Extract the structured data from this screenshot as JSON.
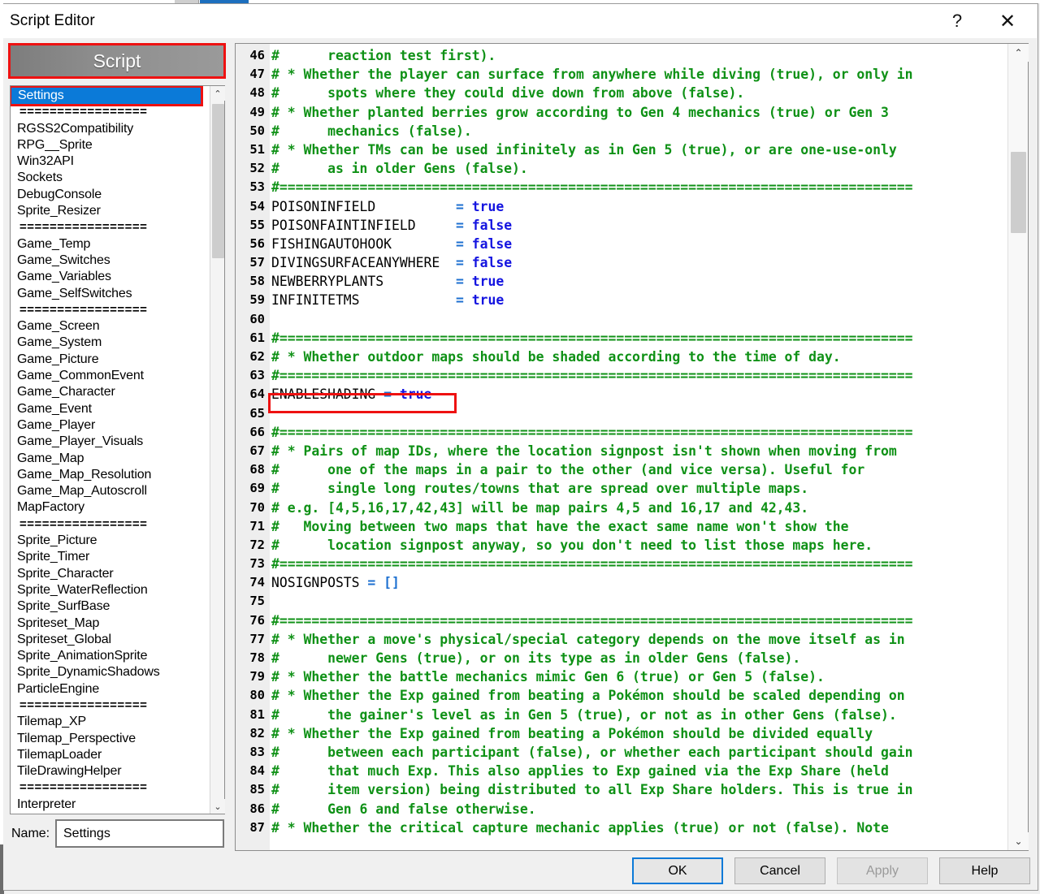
{
  "window": {
    "title": "Script Editor",
    "help_button": "?",
    "close_button": "✕"
  },
  "left_pane": {
    "header_label": "Script",
    "header_accent_color": "#ee1111",
    "selection_color": "#0b7ad8",
    "scrollbar": {
      "up_arrow": "⌃",
      "down_arrow": "⌄"
    },
    "items": [
      {
        "label": "Settings",
        "selected": true,
        "separator": false
      },
      {
        "label": "=================",
        "selected": false,
        "separator": true
      },
      {
        "label": "RGSS2Compatibility",
        "selected": false,
        "separator": false
      },
      {
        "label": "RPG__Sprite",
        "selected": false,
        "separator": false
      },
      {
        "label": "Win32API",
        "selected": false,
        "separator": false
      },
      {
        "label": "Sockets",
        "selected": false,
        "separator": false
      },
      {
        "label": "DebugConsole",
        "selected": false,
        "separator": false
      },
      {
        "label": "Sprite_Resizer",
        "selected": false,
        "separator": false
      },
      {
        "label": "=================",
        "selected": false,
        "separator": true
      },
      {
        "label": "Game_Temp",
        "selected": false,
        "separator": false
      },
      {
        "label": "Game_Switches",
        "selected": false,
        "separator": false
      },
      {
        "label": "Game_Variables",
        "selected": false,
        "separator": false
      },
      {
        "label": "Game_SelfSwitches",
        "selected": false,
        "separator": false
      },
      {
        "label": "=================",
        "selected": false,
        "separator": true
      },
      {
        "label": "Game_Screen",
        "selected": false,
        "separator": false
      },
      {
        "label": "Game_System",
        "selected": false,
        "separator": false
      },
      {
        "label": "Game_Picture",
        "selected": false,
        "separator": false
      },
      {
        "label": "Game_CommonEvent",
        "selected": false,
        "separator": false
      },
      {
        "label": "Game_Character",
        "selected": false,
        "separator": false
      },
      {
        "label": "Game_Event",
        "selected": false,
        "separator": false
      },
      {
        "label": "Game_Player",
        "selected": false,
        "separator": false
      },
      {
        "label": "Game_Player_Visuals",
        "selected": false,
        "separator": false
      },
      {
        "label": "Game_Map",
        "selected": false,
        "separator": false
      },
      {
        "label": "Game_Map_Resolution",
        "selected": false,
        "separator": false
      },
      {
        "label": "Game_Map_Autoscroll",
        "selected": false,
        "separator": false
      },
      {
        "label": "MapFactory",
        "selected": false,
        "separator": false
      },
      {
        "label": "=================",
        "selected": false,
        "separator": true
      },
      {
        "label": "Sprite_Picture",
        "selected": false,
        "separator": false
      },
      {
        "label": "Sprite_Timer",
        "selected": false,
        "separator": false
      },
      {
        "label": "Sprite_Character",
        "selected": false,
        "separator": false
      },
      {
        "label": "Sprite_WaterReflection",
        "selected": false,
        "separator": false
      },
      {
        "label": "Sprite_SurfBase",
        "selected": false,
        "separator": false
      },
      {
        "label": "Spriteset_Map",
        "selected": false,
        "separator": false
      },
      {
        "label": "Spriteset_Global",
        "selected": false,
        "separator": false
      },
      {
        "label": "Sprite_AnimationSprite",
        "selected": false,
        "separator": false
      },
      {
        "label": "Sprite_DynamicShadows",
        "selected": false,
        "separator": false
      },
      {
        "label": "ParticleEngine",
        "selected": false,
        "separator": false
      },
      {
        "label": "=================",
        "selected": false,
        "separator": true
      },
      {
        "label": "Tilemap_XP",
        "selected": false,
        "separator": false
      },
      {
        "label": "Tilemap_Perspective",
        "selected": false,
        "separator": false
      },
      {
        "label": "TilemapLoader",
        "selected": false,
        "separator": false
      },
      {
        "label": "TileDrawingHelper",
        "selected": false,
        "separator": false
      },
      {
        "label": "=================",
        "selected": false,
        "separator": true
      },
      {
        "label": "Interpreter",
        "selected": false,
        "separator": false
      }
    ]
  },
  "name_row": {
    "label": "Name:",
    "value": "Settings"
  },
  "editor": {
    "highlight_color": "#ee1111",
    "scrollbar": {
      "up_arrow": "⌃",
      "down_arrow": "⌄"
    },
    "lines": [
      {
        "n": "46",
        "segs": [
          {
            "t": "#      reaction test first).",
            "c": "cm"
          }
        ]
      },
      {
        "n": "47",
        "segs": [
          {
            "t": "# * Whether the player can surface from anywhere while diving (true), or only in",
            "c": "cm"
          }
        ]
      },
      {
        "n": "48",
        "segs": [
          {
            "t": "#      spots where they could dive down from above (false).",
            "c": "cm"
          }
        ]
      },
      {
        "n": "49",
        "segs": [
          {
            "t": "# * Whether planted berries grow according to Gen 4 mechanics (true) or Gen 3",
            "c": "cm"
          }
        ]
      },
      {
        "n": "50",
        "segs": [
          {
            "t": "#      mechanics (false).",
            "c": "cm"
          }
        ]
      },
      {
        "n": "51",
        "segs": [
          {
            "t": "# * Whether TMs can be used infinitely as in Gen 5 (true), or are one-use-only",
            "c": "cm"
          }
        ]
      },
      {
        "n": "52",
        "segs": [
          {
            "t": "#      as in older Gens (false).",
            "c": "cm"
          }
        ]
      },
      {
        "n": "53",
        "segs": [
          {
            "t": "#===============================================================================",
            "c": "cm"
          }
        ]
      },
      {
        "n": "54",
        "segs": [
          {
            "t": "POISONINFIELD          ",
            "c": "ident"
          },
          {
            "t": "= ",
            "c": "op"
          },
          {
            "t": "true",
            "c": "kwv"
          }
        ]
      },
      {
        "n": "55",
        "segs": [
          {
            "t": "POISONFAINTINFIELD     ",
            "c": "ident"
          },
          {
            "t": "= ",
            "c": "op"
          },
          {
            "t": "false",
            "c": "kwv"
          }
        ]
      },
      {
        "n": "56",
        "segs": [
          {
            "t": "FISHINGAUTOHOOK        ",
            "c": "ident"
          },
          {
            "t": "= ",
            "c": "op"
          },
          {
            "t": "false",
            "c": "kwv"
          }
        ]
      },
      {
        "n": "57",
        "segs": [
          {
            "t": "DIVINGSURFACEANYWHERE  ",
            "c": "ident"
          },
          {
            "t": "= ",
            "c": "op"
          },
          {
            "t": "false",
            "c": "kwv"
          }
        ]
      },
      {
        "n": "58",
        "segs": [
          {
            "t": "NEWBERRYPLANTS         ",
            "c": "ident"
          },
          {
            "t": "= ",
            "c": "op"
          },
          {
            "t": "true",
            "c": "kwv"
          }
        ]
      },
      {
        "n": "59",
        "segs": [
          {
            "t": "INFINITETMS            ",
            "c": "ident"
          },
          {
            "t": "= ",
            "c": "op"
          },
          {
            "t": "true",
            "c": "kwv"
          }
        ]
      },
      {
        "n": "60",
        "segs": []
      },
      {
        "n": "61",
        "segs": [
          {
            "t": "#===============================================================================",
            "c": "cm"
          }
        ]
      },
      {
        "n": "62",
        "segs": [
          {
            "t": "# * Whether outdoor maps should be shaded according to the time of day.",
            "c": "cm"
          }
        ]
      },
      {
        "n": "63",
        "segs": [
          {
            "t": "#===============================================================================",
            "c": "cm"
          }
        ]
      },
      {
        "n": "64",
        "segs": [
          {
            "t": "ENABLESHADING ",
            "c": "ident"
          },
          {
            "t": "= ",
            "c": "op"
          },
          {
            "t": "true",
            "c": "kwv"
          }
        ]
      },
      {
        "n": "65",
        "segs": []
      },
      {
        "n": "66",
        "segs": [
          {
            "t": "#===============================================================================",
            "c": "cm"
          }
        ]
      },
      {
        "n": "67",
        "segs": [
          {
            "t": "# * Pairs of map IDs, where the location signpost isn't shown when moving from",
            "c": "cm"
          }
        ]
      },
      {
        "n": "68",
        "segs": [
          {
            "t": "#      one of the maps in a pair to the other (and vice versa). Useful for",
            "c": "cm"
          }
        ]
      },
      {
        "n": "69",
        "segs": [
          {
            "t": "#      single long routes/towns that are spread over multiple maps.",
            "c": "cm"
          }
        ]
      },
      {
        "n": "70",
        "segs": [
          {
            "t": "# e.g. [4,5,16,17,42,43] will be map pairs 4,5 and 16,17 and 42,43.",
            "c": "cm"
          }
        ]
      },
      {
        "n": "71",
        "segs": [
          {
            "t": "#   Moving between two maps that have the exact same name won't show the",
            "c": "cm"
          }
        ]
      },
      {
        "n": "72",
        "segs": [
          {
            "t": "#      location signpost anyway, so you don't need to list those maps here.",
            "c": "cm"
          }
        ]
      },
      {
        "n": "73",
        "segs": [
          {
            "t": "#===============================================================================",
            "c": "cm"
          }
        ]
      },
      {
        "n": "74",
        "segs": [
          {
            "t": "NOSIGNPOSTS ",
            "c": "ident"
          },
          {
            "t": "= ",
            "c": "op"
          },
          {
            "t": "[]",
            "c": "brk"
          }
        ]
      },
      {
        "n": "75",
        "segs": []
      },
      {
        "n": "76",
        "segs": [
          {
            "t": "#===============================================================================",
            "c": "cm"
          }
        ]
      },
      {
        "n": "77",
        "segs": [
          {
            "t": "# * Whether a move's physical/special category depends on the move itself as in",
            "c": "cm"
          }
        ]
      },
      {
        "n": "78",
        "segs": [
          {
            "t": "#      newer Gens (true), or on its type as in older Gens (false).",
            "c": "cm"
          }
        ]
      },
      {
        "n": "79",
        "segs": [
          {
            "t": "# * Whether the battle mechanics mimic Gen 6 (true) or Gen 5 (false).",
            "c": "cm"
          }
        ]
      },
      {
        "n": "80",
        "segs": [
          {
            "t": "# * Whether the Exp gained from beating a Pokémon should be scaled depending on",
            "c": "cm"
          }
        ]
      },
      {
        "n": "81",
        "segs": [
          {
            "t": "#      the gainer's level as in Gen 5 (true), or not as in other Gens (false).",
            "c": "cm"
          }
        ]
      },
      {
        "n": "82",
        "segs": [
          {
            "t": "# * Whether the Exp gained from beating a Pokémon should be divided equally",
            "c": "cm"
          }
        ]
      },
      {
        "n": "83",
        "segs": [
          {
            "t": "#      between each participant (false), or whether each participant should gain",
            "c": "cm"
          }
        ]
      },
      {
        "n": "84",
        "segs": [
          {
            "t": "#      that much Exp. This also applies to Exp gained via the Exp Share (held",
            "c": "cm"
          }
        ]
      },
      {
        "n": "85",
        "segs": [
          {
            "t": "#      item version) being distributed to all Exp Share holders. This is true in",
            "c": "cm"
          }
        ]
      },
      {
        "n": "86",
        "segs": [
          {
            "t": "#      Gen 6 and false otherwise.",
            "c": "cm"
          }
        ]
      },
      {
        "n": "87",
        "segs": [
          {
            "t": "# * Whether the critical capture mechanic applies (true) or not (false). Note",
            "c": "cm"
          }
        ]
      }
    ]
  },
  "buttons": {
    "ok": "OK",
    "cancel": "Cancel",
    "apply": "Apply",
    "help": "Help"
  }
}
